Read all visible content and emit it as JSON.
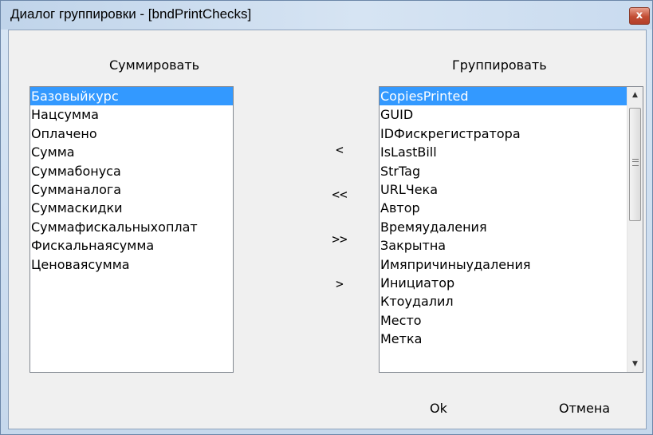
{
  "window": {
    "title": "Диалог группировки - [bndPrintChecks]",
    "close_symbol": "x"
  },
  "sum_panel": {
    "header": "Суммировать",
    "items": [
      "Базовыйкурс",
      "Нацсумма",
      "Оплачено",
      "Сумма",
      "Суммабонуса",
      "Сумманалога",
      "Суммаскидки",
      "Суммафискальныхоплат",
      "Фискальнаясумма",
      "Ценоваясумма"
    ],
    "selected_index": 0
  },
  "group_panel": {
    "header": "Группировать",
    "items": [
      "CopiesPrinted",
      "GUID",
      "IDФискрегистратора",
      "IsLastBill",
      "StrTag",
      "URLЧека",
      "Автор",
      "Времяудаления",
      "Закрытна",
      "Имяпричиныудаления",
      "Инициатор",
      "Ктоудалил",
      "Место",
      "Метка"
    ],
    "selected_index": 0
  },
  "transfer_buttons": {
    "move_one_left": "<",
    "move_all_left": "<<",
    "move_all_right": ">>",
    "move_one_right": ">"
  },
  "actions": {
    "ok": "Ok",
    "cancel": "Отмена"
  }
}
